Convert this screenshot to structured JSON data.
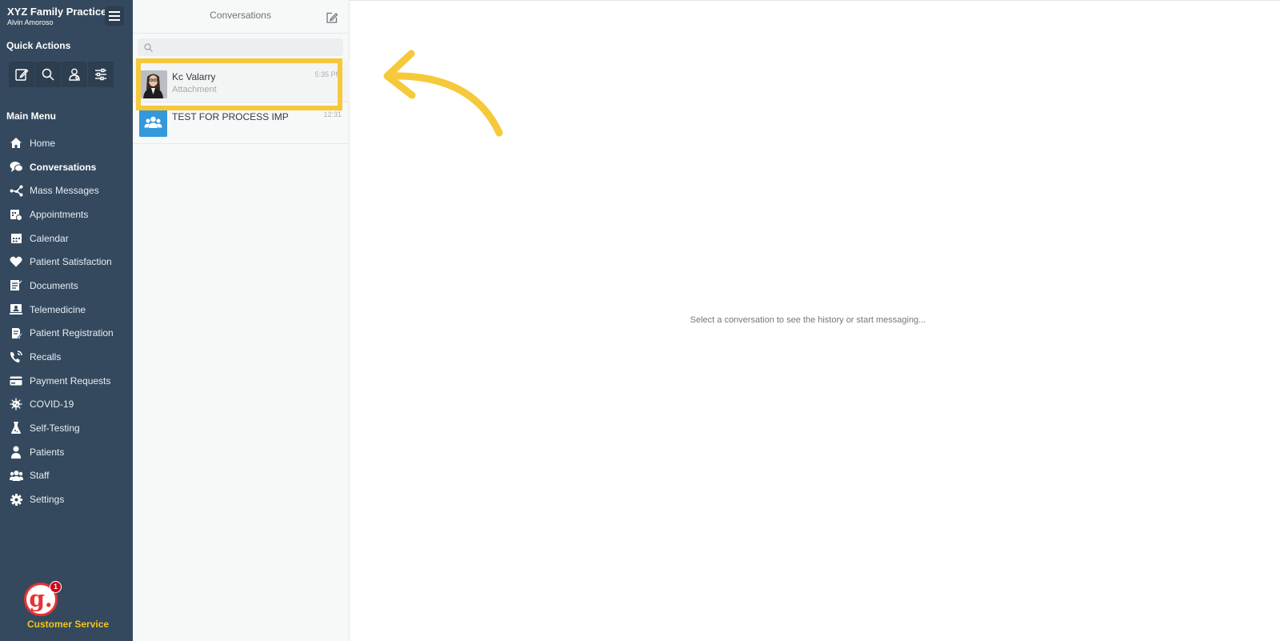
{
  "sidebar": {
    "brand_title": "XYZ Family Practice",
    "brand_user": "Alvin Amoroso",
    "quick_actions_title": "Quick Actions",
    "quick_actions": [
      {
        "icon": "compose-icon"
      },
      {
        "icon": "search-icon"
      },
      {
        "icon": "patient-add-icon"
      },
      {
        "icon": "sliders-icon"
      }
    ],
    "main_menu_title": "Main Menu",
    "items": [
      {
        "label": "Home",
        "icon": "home-icon"
      },
      {
        "label": "Conversations",
        "icon": "chat-icon",
        "active": true
      },
      {
        "label": "Mass Messages",
        "icon": "broadcast-icon"
      },
      {
        "label": "Appointments",
        "icon": "appointment-icon"
      },
      {
        "label": "Calendar",
        "icon": "calendar-icon"
      },
      {
        "label": "Patient Satisfaction",
        "icon": "heart-icon"
      },
      {
        "label": "Documents",
        "icon": "document-icon"
      },
      {
        "label": "Telemedicine",
        "icon": "telemedicine-icon"
      },
      {
        "label": "Patient Registration",
        "icon": "registration-icon"
      },
      {
        "label": "Recalls",
        "icon": "phone-icon"
      },
      {
        "label": "Payment Requests",
        "icon": "credit-card-icon"
      },
      {
        "label": "COVID-19",
        "icon": "virus-icon"
      },
      {
        "label": "Self-Testing",
        "icon": "flask-icon"
      },
      {
        "label": "Patients",
        "icon": "person-icon"
      },
      {
        "label": "Staff",
        "icon": "group-icon"
      },
      {
        "label": "Settings",
        "icon": "gear-icon"
      }
    ],
    "customer_service": {
      "logo_letter": "g.",
      "badge": "1",
      "label": "Customer Service"
    }
  },
  "conversations": {
    "title": "Conversations",
    "search_placeholder": "",
    "items": [
      {
        "name": "Kc Valarry",
        "subtitle": "Attachment",
        "time": "5:35 PM",
        "avatar": "photo"
      },
      {
        "name": "TEST FOR PROCESS IMPR...",
        "subtitle": "",
        "time": "12:31",
        "avatar": "group"
      }
    ]
  },
  "main": {
    "empty_message": "Select a conversation to see the history or start messaging..."
  },
  "colors": {
    "sidebar_bg": "#34495e",
    "highlight": "#f6c93b",
    "accent_blue": "#3498db",
    "customer_service_text": "#f5c518"
  }
}
